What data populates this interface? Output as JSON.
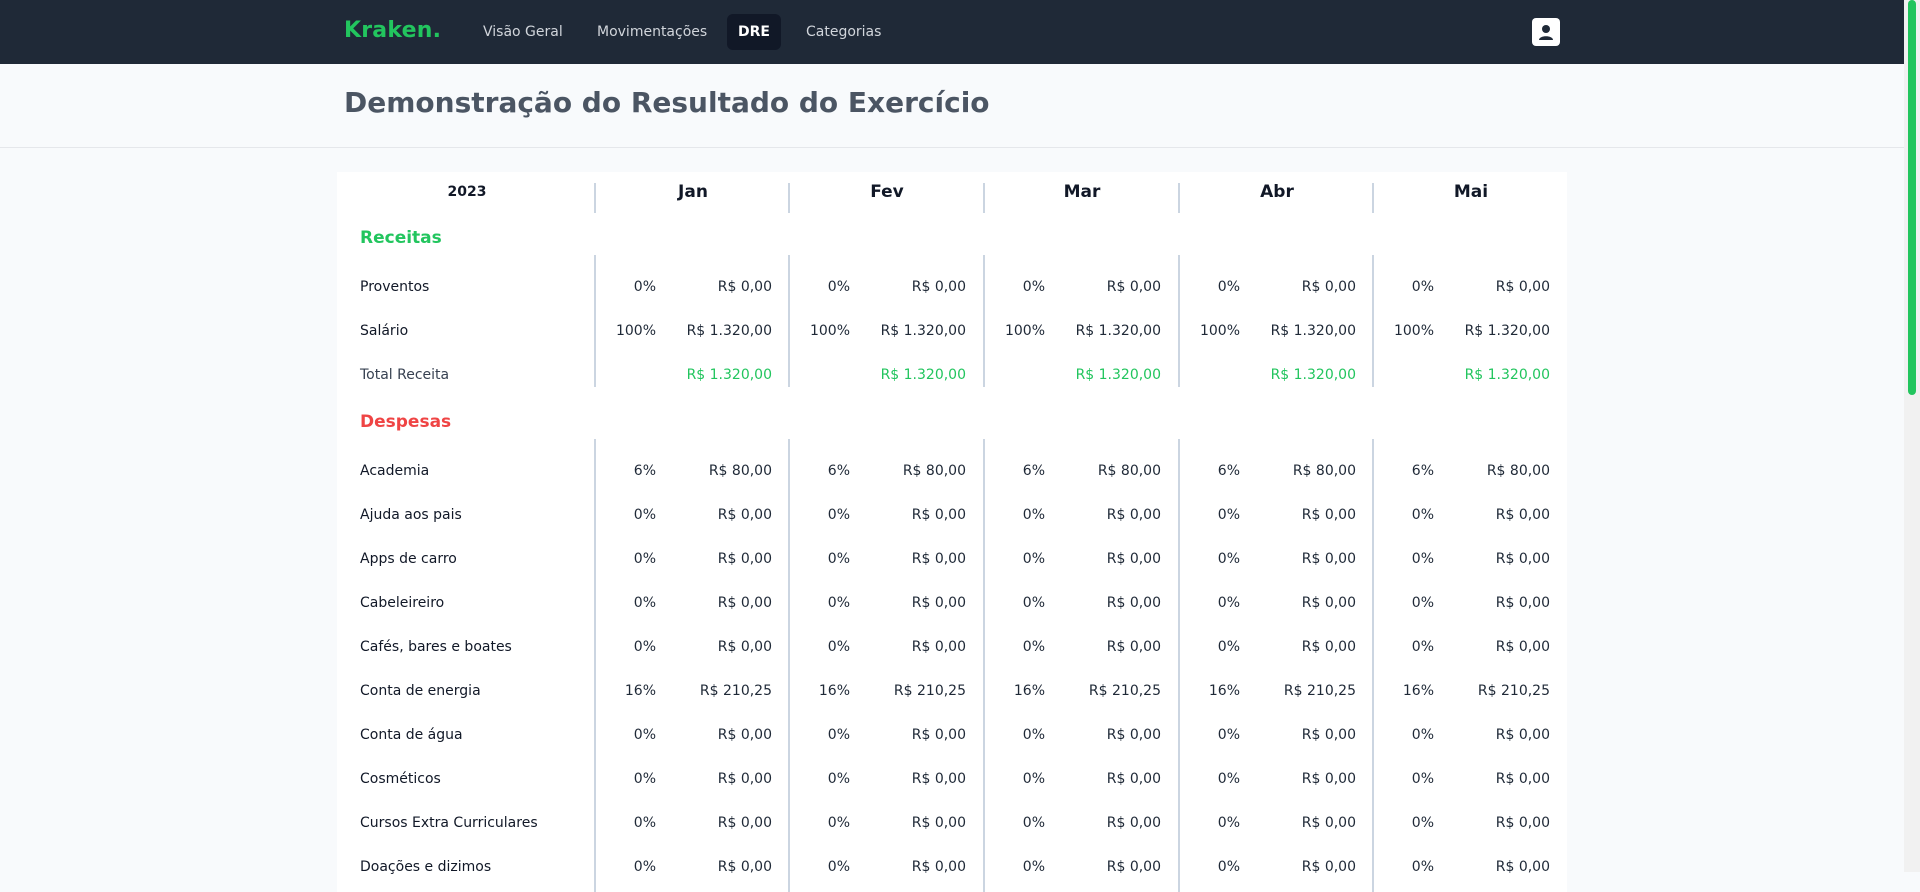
{
  "nav": {
    "logo": "Kraken.",
    "links": [
      "Visão Geral",
      "Movimentações",
      "DRE",
      "Categorias"
    ],
    "active": "DRE"
  },
  "page": {
    "title": "Demonstração do Resultado do Exercício"
  },
  "table": {
    "year": "2023",
    "months": [
      "Jan",
      "Fev",
      "Mar",
      "Abr",
      "Mai"
    ],
    "receitas": {
      "title": "Receitas",
      "color": "#22c55e",
      "rows": [
        {
          "label": "Proventos",
          "pcts": [
            "0%",
            "0%",
            "0%",
            "0%",
            "0%"
          ],
          "values": [
            "R$ 0,00",
            "R$ 0,00",
            "R$ 0,00",
            "R$ 0,00",
            "R$ 0,00"
          ]
        },
        {
          "label": "Salário",
          "pcts": [
            "100%",
            "100%",
            "100%",
            "100%",
            "100%"
          ],
          "values": [
            "R$ 1.320,00",
            "R$ 1.320,00",
            "R$ 1.320,00",
            "R$ 1.320,00",
            "R$ 1.320,00"
          ]
        }
      ],
      "total": {
        "label": "Total Receita",
        "values": [
          "R$ 1.320,00",
          "R$ 1.320,00",
          "R$ 1.320,00",
          "R$ 1.320,00",
          "R$ 1.320,00"
        ]
      }
    },
    "despesas": {
      "title": "Despesas",
      "color": "#ef4444",
      "rows": [
        {
          "label": "Academia",
          "pcts": [
            "6%",
            "6%",
            "6%",
            "6%",
            "6%"
          ],
          "values": [
            "R$ 80,00",
            "R$ 80,00",
            "R$ 80,00",
            "R$ 80,00",
            "R$ 80,00"
          ]
        },
        {
          "label": "Ajuda aos pais",
          "pcts": [
            "0%",
            "0%",
            "0%",
            "0%",
            "0%"
          ],
          "values": [
            "R$ 0,00",
            "R$ 0,00",
            "R$ 0,00",
            "R$ 0,00",
            "R$ 0,00"
          ]
        },
        {
          "label": "Apps de carro",
          "pcts": [
            "0%",
            "0%",
            "0%",
            "0%",
            "0%"
          ],
          "values": [
            "R$ 0,00",
            "R$ 0,00",
            "R$ 0,00",
            "R$ 0,00",
            "R$ 0,00"
          ]
        },
        {
          "label": "Cabeleireiro",
          "pcts": [
            "0%",
            "0%",
            "0%",
            "0%",
            "0%"
          ],
          "values": [
            "R$ 0,00",
            "R$ 0,00",
            "R$ 0,00",
            "R$ 0,00",
            "R$ 0,00"
          ]
        },
        {
          "label": "Cafés, bares e boates",
          "pcts": [
            "0%",
            "0%",
            "0%",
            "0%",
            "0%"
          ],
          "values": [
            "R$ 0,00",
            "R$ 0,00",
            "R$ 0,00",
            "R$ 0,00",
            "R$ 0,00"
          ]
        },
        {
          "label": "Conta de energia",
          "pcts": [
            "16%",
            "16%",
            "16%",
            "16%",
            "16%"
          ],
          "values": [
            "R$ 210,25",
            "R$ 210,25",
            "R$ 210,25",
            "R$ 210,25",
            "R$ 210,25"
          ]
        },
        {
          "label": "Conta de água",
          "pcts": [
            "0%",
            "0%",
            "0%",
            "0%",
            "0%"
          ],
          "values": [
            "R$ 0,00",
            "R$ 0,00",
            "R$ 0,00",
            "R$ 0,00",
            "R$ 0,00"
          ]
        },
        {
          "label": "Cosméticos",
          "pcts": [
            "0%",
            "0%",
            "0%",
            "0%",
            "0%"
          ],
          "values": [
            "R$ 0,00",
            "R$ 0,00",
            "R$ 0,00",
            "R$ 0,00",
            "R$ 0,00"
          ]
        },
        {
          "label": "Cursos Extra Curriculares",
          "pcts": [
            "0%",
            "0%",
            "0%",
            "0%",
            "0%"
          ],
          "values": [
            "R$ 0,00",
            "R$ 0,00",
            "R$ 0,00",
            "R$ 0,00",
            "R$ 0,00"
          ]
        },
        {
          "label": "Doações e dizimos",
          "pcts": [
            "0%",
            "0%",
            "0%",
            "0%",
            "0%"
          ],
          "values": [
            "R$ 0,00",
            "R$ 0,00",
            "R$ 0,00",
            "R$ 0,00",
            "R$ 0,00"
          ]
        }
      ]
    }
  }
}
